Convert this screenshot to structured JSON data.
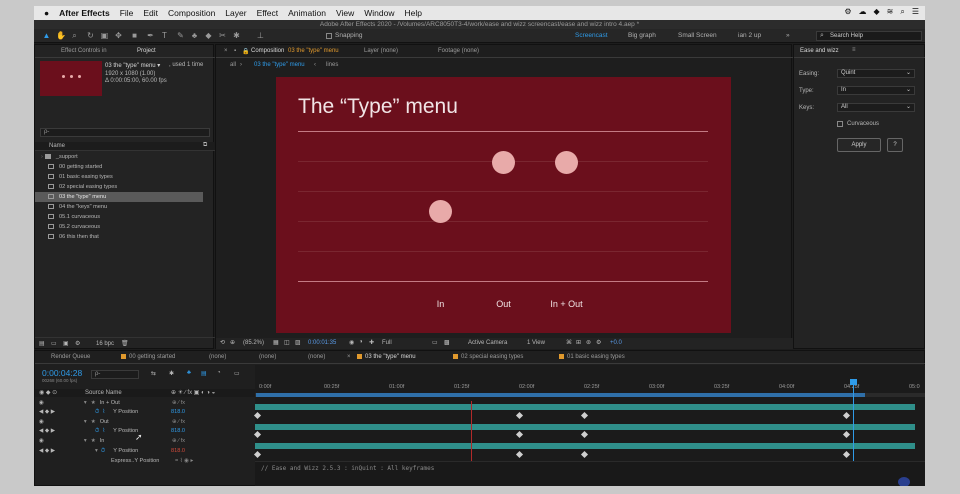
{
  "menubar": {
    "apple": "",
    "app": "After Effects",
    "items": [
      "File",
      "Edit",
      "Composition",
      "Layer",
      "Effect",
      "Animation",
      "View",
      "Window",
      "Help"
    ],
    "status_icons": [
      "gear-icon",
      "cloud-icon",
      "dropbox-icon",
      "wifi-icon",
      "search-icon",
      "menu-icon"
    ]
  },
  "title": "Adobe After Effects 2020 - /Volumes/ARC8050T3-4/work/ease and wizz screencast/ease and wizz intro 4.aep *",
  "toolbar": {
    "snapping": "Snapping",
    "workspaces": [
      "Screencast",
      "Big graph",
      "Small Screen",
      "ian 2 up"
    ],
    "search_placeholder": "Search Help"
  },
  "project": {
    "tab_effect": "Effect Controls in",
    "tab_project": "Project",
    "thumb_name": "03 the \"type\" menu ▾",
    "thumb_used": ", used 1 time",
    "thumb_size": "1920 x 1080 (1.00)",
    "thumb_dur": "Δ 0:00:05:00, 60.00 fps",
    "search_placeholder": "ρ-",
    "col_name": "Name",
    "items": [
      "_support",
      "00 getting started",
      "01 basic easing types",
      "02 special easing types",
      "03 the \"type\" menu",
      "04 the \"keys\" menu",
      "05.1 curvaceous",
      "05.2 curvaceous",
      "06 this then that"
    ],
    "bpc": "16 bpc"
  },
  "viewer": {
    "tab_comp": "Composition",
    "tab_comp_name": "03 the \"type\" menu",
    "tab_layer": "Layer (none)",
    "tab_footage": "Footage (none)",
    "crumbs": [
      "all",
      "03 the \"type\" menu",
      "lines"
    ],
    "comp_title": "The “Type” menu",
    "labels": [
      "In",
      "Out",
      "In + Out"
    ],
    "zoom": "(85.2%)",
    "timecode": "0:00:01:35",
    "resolution": "Full",
    "camera": "Active Camera",
    "views": "1 View",
    "exposure": "+0.0",
    "bg_color": "#6b0f1c"
  },
  "ease": {
    "title": "Ease and wizz",
    "easing_label": "Easing:",
    "easing_value": "Quint",
    "type_label": "Type:",
    "type_value": "In",
    "keys_label": "Keys:",
    "keys_value": "All",
    "curvaceous": "Curvaceous",
    "apply": "Apply",
    "help": "?"
  },
  "timeline": {
    "tabs": [
      "Render Queue",
      "00 getting started",
      "(none)",
      "(none)",
      "(none)",
      "03 the \"type\" menu",
      "02 special easing types",
      "01 basic easing types"
    ],
    "timecode": "0:00:04:28",
    "frame_info": "00268 (60.00 fps)",
    "search_placeholder": "ρ-",
    "source_name": "Source Name",
    "rows": [
      "In + Out",
      "Y Position",
      "Out",
      "Y Position",
      "In",
      "Y Position",
      "Express..Y Position"
    ],
    "values": [
      "818.0",
      "818.0",
      "818.0"
    ],
    "ticks": [
      "0:00f",
      "00:25f",
      "01:00f",
      "01:25f",
      "02:00f",
      "02:25f",
      "03:00f",
      "03:25f",
      "04:00f",
      "04:25f",
      "05:0"
    ],
    "expression": "// Ease and Wizz 2.5.3 : inQuint : All keyframes"
  },
  "colors": {
    "accent": "#2f9be8",
    "label": "#e0992d",
    "track": "#2f8f8a",
    "playhead": "#2f9be8"
  }
}
